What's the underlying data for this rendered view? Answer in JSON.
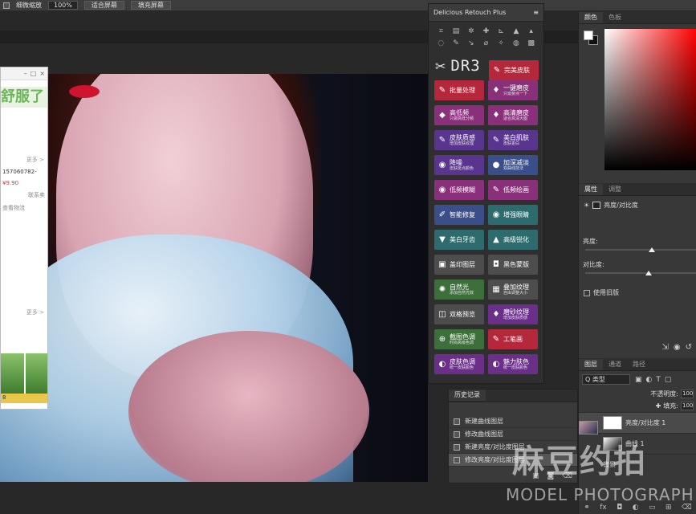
{
  "options_bar": {
    "scrubby_zoom_label": "细微缩放",
    "zoom_value": "100%",
    "fit_screen_button": "适合屏幕",
    "fill_screen_button": "填充屏幕"
  },
  "browser_window": {
    "close_glyph": "×",
    "banner_text": "舒服了",
    "line_order": "157060782-",
    "price": "¥9.90",
    "contact_seller": "联系卖",
    "view_logistics": "查看物流",
    "more_1": "更多 >",
    "more_2": "更多 >",
    "bottom_label": "8"
  },
  "plugin_panel": {
    "title": "Delicious Retouch Plus",
    "logo": "DR3",
    "buttons": [
      {
        "icon": "brush-icon",
        "glyph": "✎",
        "label": "完美皮肤",
        "sub": "",
        "color": "red"
      },
      {
        "icon": "brush-icon",
        "glyph": "✎",
        "label": "批量处理",
        "sub": "",
        "color": "red"
      },
      {
        "icon": "bottle-icon",
        "glyph": "♦",
        "label": "一键磨皮",
        "sub": "只需要点一下",
        "color": "mag"
      },
      {
        "icon": "diamond-icon",
        "glyph": "◆",
        "label": "高低频",
        "sub": "只做高低分频",
        "color": "mag"
      },
      {
        "icon": "bottle-icon",
        "glyph": "♦",
        "label": "高清磨皮",
        "sub": "适合高清大图",
        "color": "mag"
      },
      {
        "icon": "brush-icon",
        "glyph": "✎",
        "label": "皮肤质感",
        "sub": "增加皮肤纹理",
        "color": "vio"
      },
      {
        "icon": "brush-icon",
        "glyph": "✎",
        "label": "美白肌肤",
        "sub": "皮肤更白",
        "color": "vio"
      },
      {
        "icon": "circle-icon",
        "glyph": "◉",
        "label": "降噪",
        "sub": "皮肤斑点颜色",
        "color": "vio"
      },
      {
        "icon": "circle-icon",
        "glyph": "●",
        "label": "加深减淡",
        "sub": "双曲线技法",
        "color": "blu"
      },
      {
        "icon": "circle-icon",
        "glyph": "◉",
        "label": "低频模糊",
        "sub": "",
        "color": "mag"
      },
      {
        "icon": "brush-icon",
        "glyph": "✎",
        "label": "低频绘画",
        "sub": "",
        "color": "mag"
      },
      {
        "icon": "pen-icon",
        "glyph": "✐",
        "label": "智能修复",
        "sub": "",
        "color": "blu"
      },
      {
        "icon": "eye-icon",
        "glyph": "◉",
        "label": "增强眼睛",
        "sub": "",
        "color": "tea"
      },
      {
        "icon": "tooth-icon",
        "glyph": "▼",
        "label": "美白牙齿",
        "sub": "",
        "color": "tea"
      },
      {
        "icon": "triangle-icon",
        "glyph": "▲",
        "label": "高级锐化",
        "sub": "",
        "color": "tea"
      },
      {
        "icon": "stamp-icon",
        "glyph": "▣",
        "label": "盖印图层",
        "sub": "",
        "color": "gry"
      },
      {
        "icon": "mask-icon",
        "glyph": "◘",
        "label": "黑色蒙版",
        "sub": "",
        "color": "gry"
      },
      {
        "icon": "sun-icon",
        "glyph": "✺",
        "label": "自然光",
        "sub": "添加自然光效",
        "color": "grn"
      },
      {
        "icon": "texture-icon",
        "glyph": "▦",
        "label": "叠加纹理",
        "sub": "自由调整大小",
        "color": "gry"
      },
      {
        "icon": "compare-icon",
        "glyph": "◫",
        "label": "双格预览",
        "sub": "",
        "color": "gry"
      },
      {
        "icon": "bottle-icon",
        "glyph": "♦",
        "label": "磨砂纹理",
        "sub": "增加皮肤质感",
        "color": "pur"
      },
      {
        "icon": "color-icon",
        "glyph": "⊕",
        "label": "截图色调",
        "sub": "时尚高级色调",
        "color": "grn"
      },
      {
        "icon": "brush-icon",
        "glyph": "✎",
        "label": "工笔画",
        "sub": "",
        "color": "red"
      },
      {
        "icon": "palette-icon",
        "glyph": "◐",
        "label": "皮肤色调",
        "sub": "统一皮肤颜色",
        "color": "pur"
      },
      {
        "icon": "palette-icon",
        "glyph": "◐",
        "label": "魅力肤色",
        "sub": "统一皮肤颜色",
        "color": "pur"
      }
    ]
  },
  "color_panel": {
    "tab_color": "颜色",
    "tab_swatches": "色板"
  },
  "properties_panel": {
    "tab_properties": "属性",
    "tab_adjustments": "调整",
    "adjustment_name": "亮度/对比度",
    "brightness_label": "亮度:",
    "contrast_label": "对比度:",
    "brightness_level": 0.6,
    "contrast_level": 0.57,
    "use_legacy_label": "使用旧版"
  },
  "layers_panel": {
    "tab_layers": "图层",
    "tab_channels": "通道",
    "tab_paths": "路径",
    "kind_filter": "Q 类型",
    "opacity_label": "不透明度:",
    "opacity_value": "100",
    "fill_label": "填充:",
    "fill_value": "100",
    "layers": [
      {
        "name": "亮度/对比度 1",
        "thumb": "white",
        "selected": true
      },
      {
        "name": "曲线 1",
        "thumb": "curve",
        "selected": false
      },
      {
        "name": "背景",
        "thumb": "photo",
        "selected": false
      }
    ]
  },
  "history_panel": {
    "tab_history": "历史记录",
    "items": [
      "新建曲线图层",
      "修改曲线图层",
      "新建亮度/对比度图层",
      "修改亮度/对比度图层"
    ]
  },
  "watermark": {
    "cn": "麻豆约拍",
    "en": "MODEL PHOTOGRAPH"
  }
}
